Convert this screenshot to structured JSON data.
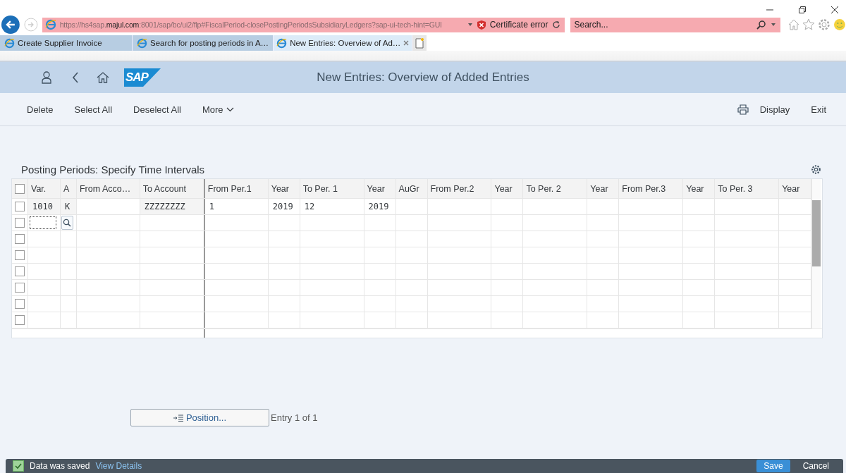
{
  "browser": {
    "address": "https://hs4sap.**majul.com**:8001/sap/bc/ui2/flp#FiscalPeriod-closePostingPeriodsSubsidiaryLedgers?sap-ui-tech-hint=GUI",
    "certificate_error": "Certificate error",
    "search_placeholder": "Search...",
    "tabs": [
      {
        "label": "Create Supplier Invoice",
        "selected": false
      },
      {
        "label": "Search for posting periods in A…",
        "selected": false
      },
      {
        "label": "New Entries: Overview of Ad…",
        "selected": true
      }
    ]
  },
  "shell": {
    "logo": "SAP",
    "title": "New Entries: Overview of Added Entries"
  },
  "toolbar": {
    "left": [
      "Delete",
      "Select All",
      "Deselect All"
    ],
    "more": "More",
    "right": [
      "Display",
      "Exit"
    ]
  },
  "table": {
    "title": "Posting Periods: Specify Time Intervals",
    "select_all_checked": false,
    "columns": [
      "Var.",
      "A",
      "From Acco…",
      "To Account",
      "From Per.1",
      "Year",
      "To Per. 1",
      "Year",
      "AuGr",
      "From Per.2",
      "Year",
      "To Per. 2",
      "Year",
      "From Per.3",
      "Year",
      "To Per. 3",
      "Year"
    ],
    "rows": [
      {
        "kind": "data",
        "checked": false,
        "cells": [
          "1010",
          "K",
          null,
          "ZZZZZZZZ",
          "1",
          "2019",
          "12",
          "2019",
          null,
          null,
          null,
          null,
          null,
          null,
          null,
          null,
          null
        ]
      },
      {
        "kind": "input",
        "checked": false
      },
      {
        "kind": "empty",
        "checked": false
      },
      {
        "kind": "empty",
        "checked": false
      },
      {
        "kind": "empty",
        "checked": false
      },
      {
        "kind": "empty",
        "checked": false
      },
      {
        "kind": "empty",
        "checked": false
      },
      {
        "kind": "empty",
        "checked": false
      }
    ]
  },
  "position_button": "Position...",
  "entry_count": "Entry 1 of 1",
  "footer": {
    "message": "Data was saved",
    "link": "View Details",
    "buttons": [
      "Save",
      "Cancel"
    ]
  }
}
